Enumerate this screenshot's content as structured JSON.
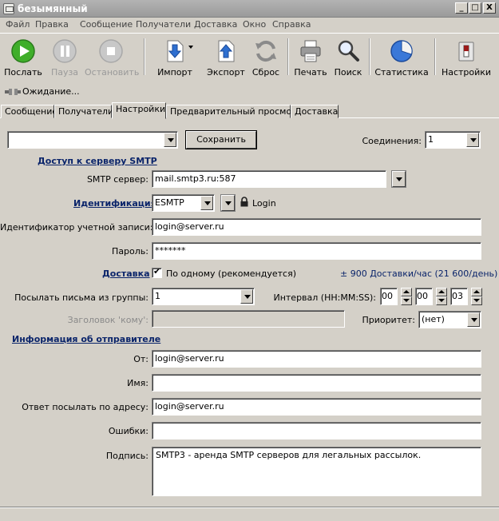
{
  "window": {
    "title": "безымянный",
    "controls": [
      "_",
      "□",
      "X"
    ]
  },
  "menu": [
    "Файл",
    "Правка",
    "Сообщение",
    "Получатели",
    "Доставка",
    "Окно",
    "Справка"
  ],
  "toolbar": {
    "send": "Послать",
    "pause": "Пауза",
    "stop": "Остановить",
    "import": "Импорт",
    "export": "Экспорт",
    "reset": "Сброс",
    "print": "Печать",
    "search": "Поиск",
    "stats": "Статистика",
    "settings": "Настройки"
  },
  "status": "Ожидание...",
  "tabs": [
    "Сообщение",
    "Получатели",
    "Настройки",
    "Предварительный просмотр",
    "Доставка"
  ],
  "form": {
    "profile_value": "",
    "save_button": "Сохранить",
    "connections_label": "Соединения:",
    "connections_value": "1",
    "smtp_section": "Доступ к серверу SMTP",
    "smtp_server_label": "SMTP сервер:",
    "smtp_server_value": "mail.smtp3.ru:587",
    "auth_section": "Идентификация",
    "auth_value": "ESMTP",
    "login_label": "Login",
    "account_label": "Идентификатор учетной записи:",
    "account_value": "login@server.ru",
    "password_label": "Пароль:",
    "password_value": "*******",
    "delivery_section": "Доставка",
    "one_by_one_label": "По одному (рекомендуется)",
    "rate_text": "± 900 Доставки/час (21 600/день)",
    "group_label": "Посылать письма из группы:",
    "group_value": "1",
    "interval_label": "Интервал (HH:MM:SS):",
    "interval_h": "00",
    "interval_m": "00",
    "interval_s": "03",
    "to_header_label": "Заголовок 'кому':",
    "to_header_value": "",
    "priority_label": "Приоритет:",
    "priority_value": "(нет)",
    "sender_section": "Информация об отправителе",
    "from_label": "От:",
    "from_value": "login@server.ru",
    "name_label": "Имя:",
    "name_value": "",
    "reply_label": "Ответ посылать по адресу:",
    "reply_value": "login@server.ru",
    "errors_label": "Ошибки:",
    "errors_value": "",
    "signature_label": "Подпись:",
    "signature_value": "SMTP3 - аренда SMTP серверов для легальных рассылок."
  }
}
